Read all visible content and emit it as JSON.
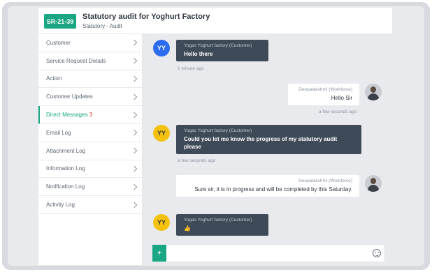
{
  "header": {
    "id": "SR-21-39",
    "title": "Statutory audit for Yoghurt Factory",
    "subtitle": "Statutory - Audit"
  },
  "sidebar": {
    "items": [
      {
        "label": "Customer"
      },
      {
        "label": "Service Request Details"
      },
      {
        "label": "Action"
      },
      {
        "label": "Customer Updates"
      },
      {
        "label": "Direct Messages",
        "count": "3",
        "active": true
      },
      {
        "label": "Email Log"
      },
      {
        "label": "Attachment Log"
      },
      {
        "label": "Information Log"
      },
      {
        "label": "Notification Log"
      },
      {
        "label": "Activity Log"
      }
    ]
  },
  "messages": [
    {
      "initials": "YY",
      "sender": "Yogas Yoghurt factory (Customer)",
      "text": "Hello there",
      "time": "1 minute ago"
    },
    {
      "sender": "Deepalakshmi (Workforce)",
      "text": "Hello Sir",
      "time": "a few seconds ago"
    },
    {
      "initials": "YY",
      "sender": "Yogas Yoghurt factory (Customer)",
      "text": "Could you let me know the progress of my statutory audit please",
      "time": "a few seconds ago"
    },
    {
      "sender": "Deepalakshmi (Workforce)",
      "text": "Sure sir, it is in progress and will be completed by this Saturday."
    },
    {
      "initials": "YY",
      "sender": "Yogas Yoghurt factory (Customer)",
      "text": "👍"
    }
  ],
  "composer": {
    "add_label": "+",
    "placeholder": "",
    "emoji_icon": "smiley-icon"
  },
  "colors": {
    "accent": "#1aa683",
    "bubble_dark": "#3e4a57",
    "avatar_blue": "#2c6cf0",
    "avatar_yellow": "#f4c20d",
    "count_red": "#e3342f"
  }
}
